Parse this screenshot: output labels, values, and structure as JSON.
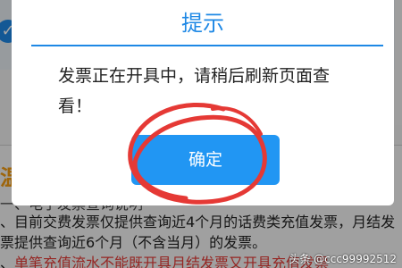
{
  "dialog": {
    "title": "提示",
    "message": "发票正在开具中，请稍后刷新页面查看！",
    "confirm_label": "确定"
  },
  "background": {
    "notice_title": "温馨",
    "lines": [
      "一、电子发票查询说明",
      "、目前交费发票仅提供查询近4个月的话费类充值发票，月结发",
      "票提供查询近6个月（不含当月）的发票。",
      "单笔充值流水不能既开具月结发票又开具充值发票"
    ],
    "line4_prefix": "、"
  },
  "watermark": "头条 @ccc99992512",
  "colors": {
    "accent": "#1e88e5",
    "button": "#2196f3",
    "annotation": "#e53935",
    "notice_title": "#f39c12"
  }
}
